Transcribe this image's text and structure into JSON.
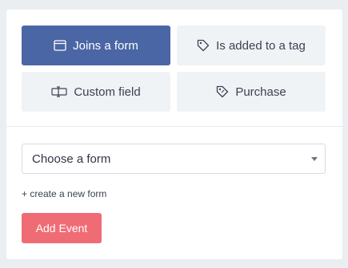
{
  "event_types": [
    {
      "label": "Joins a form",
      "icon": "form-window-icon",
      "active": true
    },
    {
      "label": "Is added to a tag",
      "icon": "tag-icon",
      "active": false
    },
    {
      "label": "Custom field",
      "icon": "custom-field-icon",
      "active": false
    },
    {
      "label": "Purchase",
      "icon": "purchase-tag-icon",
      "active": false
    }
  ],
  "form_select": {
    "value": "Choose a form"
  },
  "create_link": "+ create a new form",
  "add_button": "Add Event",
  "colors": {
    "active": "#4a66a5",
    "inactive": "#f0f3f6",
    "add_button": "#f06c75"
  }
}
